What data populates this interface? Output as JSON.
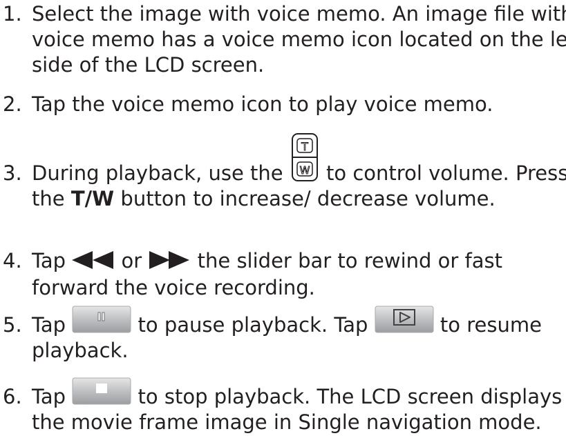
{
  "steps": [
    {
      "num": "1.",
      "lines": [
        "Select the image with voice memo. An image file with",
        "voice memo has a voice memo icon located on the left",
        "side of the LCD screen."
      ]
    },
    {
      "num": "2.",
      "lines": [
        "Tap the voice memo icon to play voice memo."
      ]
    },
    {
      "num": "3.",
      "part1": "During playback, use the",
      "part2": "to control volume. Press",
      "line2_pre": "the",
      "line2_bold": "T/W",
      "line2_post": "button to increase/ decrease volume."
    },
    {
      "num": "4.",
      "part1": "Tap",
      "part2": "or",
      "part3": "the slider bar to rewind or fast",
      "line2": "forward the voice recording."
    },
    {
      "num": "5.",
      "part1": "Tap",
      "part2": "to pause playback. Tap",
      "part3": "to resume",
      "line2": "playback."
    },
    {
      "num": "6.",
      "part1": "Tap",
      "part2": "to stop playback. The LCD screen displays",
      "line2": "the movie frame image in Single navigation mode."
    }
  ],
  "icons": {
    "tw_top_letter": "T",
    "tw_bottom_letter": "W",
    "rewind": "rewind-icon",
    "fast_forward": "fast-forward-icon",
    "pause": "pause-button-icon",
    "play": "play-button-icon",
    "stop": "stop-button-icon"
  }
}
